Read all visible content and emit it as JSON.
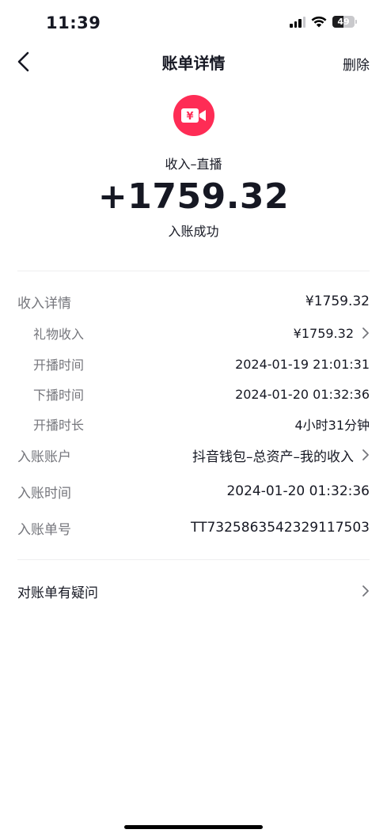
{
  "status_bar": {
    "time": "11:39",
    "battery": "49"
  },
  "nav": {
    "title": "账单详情",
    "delete_label": "删除"
  },
  "hero": {
    "icon_name": "yuan-video-icon",
    "icon_color": "#fe2c55",
    "icon_glyph": "¥",
    "type": "收入–直播",
    "amount": "+1759.32",
    "status": "入账成功"
  },
  "details": {
    "income_detail": {
      "label": "收入详情",
      "value": "¥1759.32"
    },
    "gift_income": {
      "label": "礼物收入",
      "value": "¥1759.32"
    },
    "live_start": {
      "label": "开播时间",
      "value": "2024-01-19 21:01:31"
    },
    "live_end": {
      "label": "下播时间",
      "value": "2024-01-20 01:32:36"
    },
    "live_duration": {
      "label": "开播时长",
      "value": "4小时31分钟"
    },
    "account": {
      "label": "入账账户",
      "value": "抖音钱包–总资产–我的收入"
    },
    "credit_time": {
      "label": "入账时间",
      "value": "2024-01-20 01:32:36"
    },
    "order_no": {
      "label": "入账单号",
      "value": "TT7325863542329117503"
    }
  },
  "question": {
    "label": "对账单有疑问"
  }
}
